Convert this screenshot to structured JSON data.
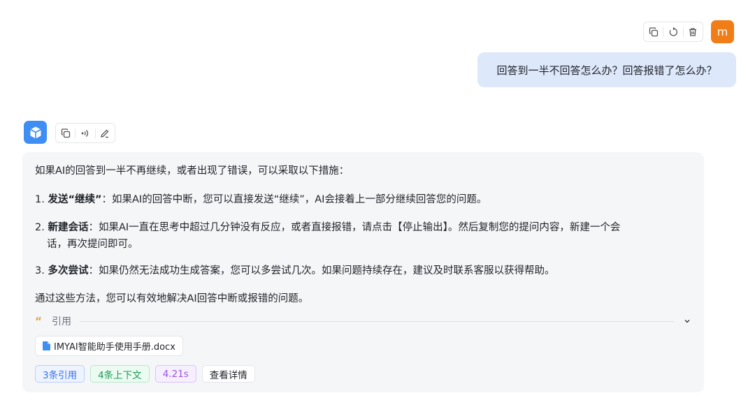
{
  "user": {
    "avatar_letter": "m",
    "message": "回答到一半不回答怎么办？回答报错了怎么办？",
    "actions": [
      "copy-icon",
      "refresh-icon",
      "trash-icon"
    ]
  },
  "assistant": {
    "actions": [
      "copy-icon",
      "speaker-icon",
      "edit-icon"
    ],
    "intro": "如果AI的回答到一半不再继续，或者出现了错误，可以采取以下措施：",
    "items": [
      {
        "num": "1. ",
        "title": "发送“继续”",
        "text": "：如果AI的回答中断，您可以直接发送“继续”，AI会接着上一部分继续回答您的问题。"
      },
      {
        "num": "2. ",
        "title": "新建会话",
        "text": "：如果AI一直在思考中超过几分钟没有反应，或者直接报错，请点击【停止输出】。然后复制您的提问内容，新建一个会",
        "text_cont": "话，再次提问即可。"
      },
      {
        "num": "3. ",
        "title": "多次尝试",
        "text": "：如果仍然无法成功生成答案，您可以多尝试几次。如果问题持续存在，建议及时联系客服以获得帮助。"
      }
    ],
    "outro": "通过这些方法，您可以有效地解决AI回答中断或报错的问题。",
    "reference": {
      "quote_mark": "“",
      "label": "引用",
      "file_name": "IMYAI智能助手使用手册.docx"
    },
    "tags": {
      "refs": "3条引用",
      "context": "4条上下文",
      "time": "4.21s",
      "details": "查看详情"
    }
  },
  "colors": {
    "user_avatar": "#f07d17",
    "user_bubble": "#dde8fb",
    "ai_avatar": "#3f8ef3",
    "ai_bubble": "#f5f6f7"
  }
}
